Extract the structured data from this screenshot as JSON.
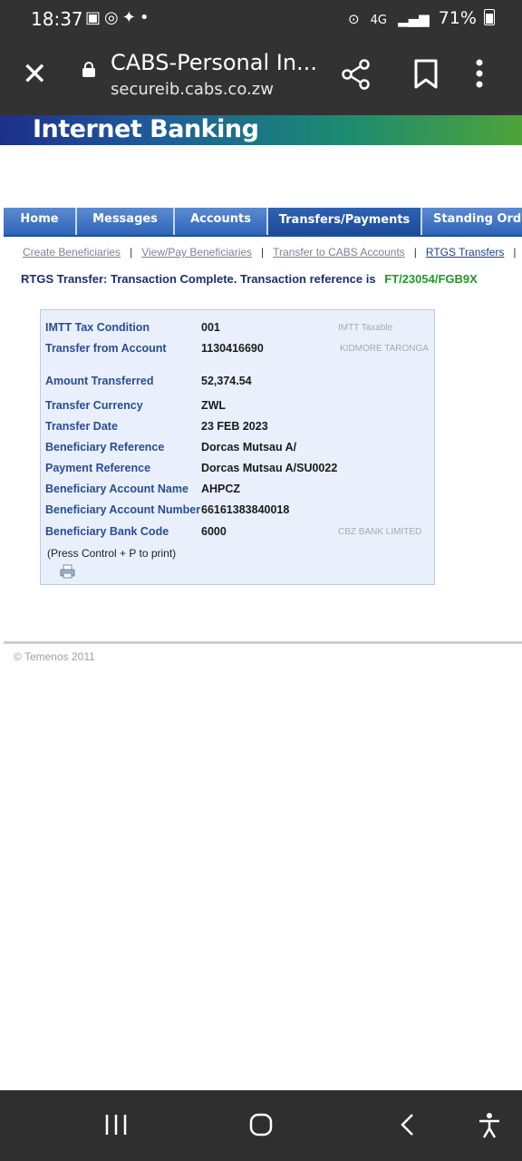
{
  "status_bar": {
    "time": "18:37",
    "network": "4G",
    "battery": "71%"
  },
  "browser": {
    "page_title": "CABS-Personal In...",
    "url": "secureib.cabs.co.zw"
  },
  "banner": {
    "brand": "Internet Banking"
  },
  "nav": {
    "tabs": [
      "Home",
      "Messages",
      "Accounts",
      "Transfers/Payments",
      "Standing Orde"
    ],
    "active": "Transfers/Payments"
  },
  "sublinks": [
    "Create Beneficiaries",
    "View/Pay Beneficiaries",
    "Transfer to CABS Accounts",
    "RTGS Transfers"
  ],
  "message": {
    "text": "RTGS Transfer: Transaction Complete. Transaction reference is",
    "reference": "FT/23054/FGB9X"
  },
  "details": {
    "imtt_tax_condition": {
      "label": "IMTT Tax Condition",
      "value": "001",
      "note": "IMTT Taxable"
    },
    "transfer_from_account": {
      "label": "Transfer from Account",
      "value": "1130416690",
      "note": "KIDMORE TARONGA"
    },
    "amount_transferred": {
      "label": "Amount Transferred",
      "value": "52,374.54"
    },
    "transfer_currency": {
      "label": "Transfer Currency",
      "value": "ZWL"
    },
    "transfer_date": {
      "label": "Transfer Date",
      "value": "23 FEB 2023"
    },
    "beneficiary_reference": {
      "label": "Beneficiary Reference",
      "value": "Dorcas Mutsau A/"
    },
    "payment_reference": {
      "label": "Payment Reference",
      "value": "Dorcas Mutsau A/SU0022"
    },
    "beneficiary_account_name": {
      "label": "Beneficiary Account Name",
      "value": "AHPCZ"
    },
    "beneficiary_account_number": {
      "label": "Beneficiary Account Number",
      "value": "66161383840018"
    },
    "beneficiary_bank_code": {
      "label": "Beneficiary Bank Code",
      "value": "6000",
      "note": "CBZ BANK LIMITED"
    },
    "print_note": "(Press Control + P to print)"
  },
  "footer": {
    "copyright": "© Temenos 2011"
  }
}
